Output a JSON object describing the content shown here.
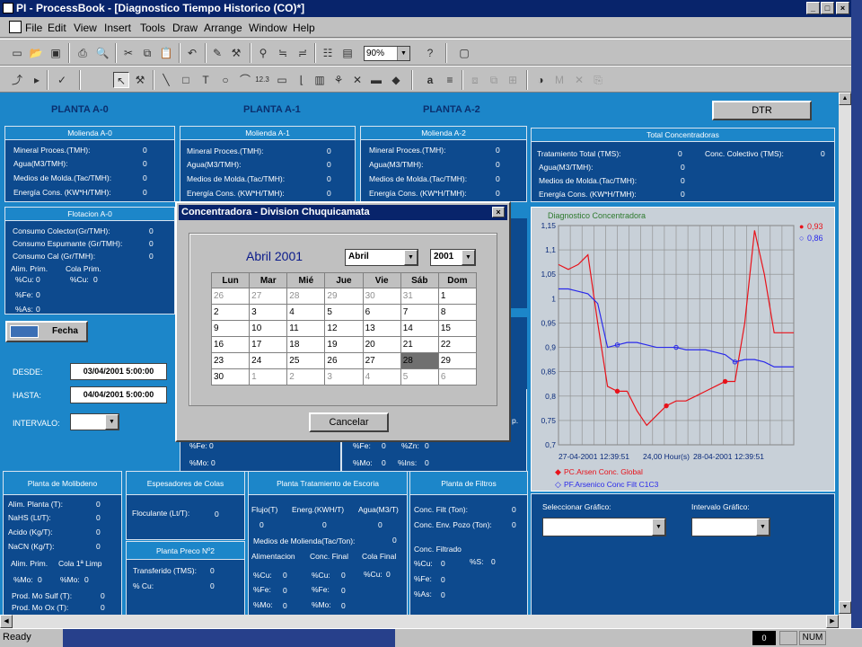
{
  "window": {
    "title": "PI - ProcessBook - [Diagnostico Tiempo Historico (CO)*]"
  },
  "menu": {
    "items": [
      "File",
      "Edit",
      "View",
      "Insert",
      "Tools",
      "Draw",
      "Arrange",
      "Window",
      "Help"
    ]
  },
  "toolbar": {
    "zoom": "90%"
  },
  "plants": [
    "PLANTA A-0",
    "PLANTA A-1",
    "PLANTA A-2"
  ],
  "dtr_button": "DTR",
  "molienda": [
    {
      "title": "Molienda A-0",
      "rows": [
        {
          "label": "Mineral Proces.(TMH):",
          "value": "0"
        },
        {
          "label": "Agua(M3/TMH):",
          "value": "0"
        },
        {
          "label": "Medios de Molda.(Tac/TMH):",
          "value": "0"
        },
        {
          "label": "Energía Cons. (KW*H/TMH):",
          "value": "0"
        }
      ]
    },
    {
      "title": "Molienda A-1",
      "rows": [
        {
          "label": "Mineral Proces.(TMH):",
          "value": "0"
        },
        {
          "label": "Agua(M3/TMH):",
          "value": "0"
        },
        {
          "label": "Medios de Molda.(Tac/TMH):",
          "value": "0"
        },
        {
          "label": "Energía Cons. (KW*H/TMH):",
          "value": "0"
        }
      ]
    },
    {
      "title": "Molienda A-2",
      "rows": [
        {
          "label": "Mineral Proces.(TMH):",
          "value": "0"
        },
        {
          "label": "Agua(M3/TMH):",
          "value": "0"
        },
        {
          "label": "Medios de Molda.(Tac/TMH):",
          "value": "0"
        },
        {
          "label": "Energía Cons. (KW*H/TMH):",
          "value": "0"
        }
      ]
    }
  ],
  "total": {
    "title": "Total Concentradoras",
    "rows": [
      {
        "label": "Tratamiento Total (TMS):",
        "value": "0"
      },
      {
        "label": "Agua(M3/TMH):",
        "value": "0"
      },
      {
        "label": "Medios de Molda.(Tac/TMH):",
        "value": "0"
      },
      {
        "label": "Energía Cons. (KW*H/TMH):",
        "value": "0"
      }
    ],
    "colectivo_label": "Conc. Colectivo (TMS):",
    "colectivo_value": "0"
  },
  "flotacion": {
    "title": "Flotacion A-0",
    "rows": [
      {
        "label": "Consumo Colector(Gr/TMH):",
        "value": "0"
      },
      {
        "label": "Consumo Espumante (Gr/TMH):",
        "value": "0"
      },
      {
        "label": "Consumo Cal (Gr/TMH):",
        "value": "0"
      }
    ],
    "alim_label": "Alim. Prim.",
    "cola_label": "Cola Prim.",
    "cu_label": "%Cu:",
    "cu_alim": "0",
    "cu_cola": "0",
    "fe_label": "%Fe:",
    "fe_value": "0",
    "as_label": "%As:",
    "as_value": "0"
  },
  "fecha": {
    "button": "Fecha",
    "desde_label": "DESDE:",
    "desde_value": "03/04/2001 5:00:00",
    "hasta_label": "HASTA:",
    "hasta_value": "04/04/2001 5:00:00",
    "intervalo_label": "INTERVALO:"
  },
  "hidden_fragments": {
    "fe_label": "%Fe:",
    "fe_value": "0",
    "mo_label": "%Mo:",
    "mo_value": "0",
    "fe2_label": "%Fe:",
    "fe2_value": "0",
    "zn_label": "%Zn:",
    "zn_value": "0",
    "mo2_label": "%Mo:",
    "mo2_value": "0",
    "ins_label": "%Ins:",
    "ins_value": "0",
    "p_label": "p."
  },
  "dialog": {
    "title": "Concentradora - Division Chuquicamata",
    "month_title": "Abril 2001",
    "month_select": "Abril",
    "year_select": "2001",
    "weekdays": [
      "Lun",
      "Mar",
      "Mié",
      "Jue",
      "Vie",
      "Sáb",
      "Dom"
    ],
    "weeks": [
      [
        "26",
        "27",
        "28",
        "29",
        "30",
        "31",
        "1"
      ],
      [
        "2",
        "3",
        "4",
        "5",
        "6",
        "7",
        "8"
      ],
      [
        "9",
        "10",
        "11",
        "12",
        "13",
        "14",
        "15"
      ],
      [
        "16",
        "17",
        "18",
        "19",
        "20",
        "21",
        "22"
      ],
      [
        "23",
        "24",
        "25",
        "26",
        "27",
        "28",
        "29"
      ],
      [
        "30",
        "1",
        "2",
        "3",
        "4",
        "5",
        "6"
      ]
    ],
    "cancel": "Cancelar"
  },
  "molibdeno": {
    "title": "Planta de Molibdeno",
    "rows": [
      {
        "label": "Alim. Planta (T):",
        "value": "0"
      },
      {
        "label": "NaHS (Lt/T):",
        "value": "0"
      },
      {
        "label": "Acido (Kg/T):",
        "value": "0"
      },
      {
        "label": "NaCN (Kg/T):",
        "value": "0"
      }
    ],
    "alim_prim": "Alim. Prim.",
    "cola_limp": "Cola 1ª Limp",
    "mo_label": "%Mo:",
    "mo_alim": "0",
    "mo_cola": "0",
    "sulf_label": "Prod. Mo Sulf (T):",
    "sulf_value": "0",
    "ox_label": "Prod. Mo Ox (T):",
    "ox_value": "0"
  },
  "espesadores": {
    "title": "Espesadores de Colas",
    "label": "Floculante (Lt/T):",
    "value": "0"
  },
  "preco": {
    "title": "Planta Preco Nº2",
    "rows": [
      {
        "label": "Transferido (TMS):",
        "value": "0"
      },
      {
        "label": "% Cu:",
        "value": "0"
      }
    ]
  },
  "escoria": {
    "title": "Planta Tratamiento de Escoria",
    "h1": [
      "Flujo(T)",
      "Energ.(KWH/T)",
      "Agua(M3/T)"
    ],
    "h1_values": [
      "0",
      "0",
      "0"
    ],
    "medios_label": "Medios de Molienda(Tac/Ton):",
    "medios_value": "0",
    "h2": [
      "Alimentacion",
      "Conc. Final",
      "Cola Final"
    ],
    "cu_label": "%Cu:",
    "fe_label": "%Fe:",
    "mo_label": "%Mo:",
    "cu_vals": [
      "0",
      "0",
      "0"
    ],
    "fe_vals": [
      "0",
      "0"
    ],
    "mo_vals": [
      "0",
      "0"
    ]
  },
  "filtros": {
    "title": "Planta de Filtros",
    "rows": [
      {
        "label": "Conc. Filt (Ton):",
        "value": "0"
      },
      {
        "label": "Conc. Env. Pozo (Ton):",
        "value": "0"
      }
    ],
    "filtrado_label": "Conc. Filtrado",
    "cu_label": "%Cu:",
    "cu_value": "0",
    "s_label": "%S:",
    "s_value": "0",
    "fe_label": "%Fe:",
    "fe_value": "0",
    "as_label": "%As:",
    "as_value": "0"
  },
  "selectors": {
    "grafico_label": "Seleccionar Gráfico:",
    "intervalo_label": "Intervalo Gráfico:"
  },
  "status": {
    "text": "Ready",
    "page": "0",
    "num": "NUM"
  },
  "chart_data": {
    "type": "line",
    "title": "Diagnostico Concentradora",
    "ylim": [
      0.7,
      1.15
    ],
    "yticks": [
      "1,15",
      "1,1",
      "1,05",
      "1",
      "0,95",
      "0,9",
      "0,85",
      "0,8",
      "0,75",
      "0,7"
    ],
    "x_start_label": "27-04-2001 12:39:51",
    "x_span_label": "24,00 Hour(s)",
    "x_end_label": "28-04-2001 12:39:51",
    "series": [
      {
        "name": "PC.Arsen Conc. Global",
        "current": "0,93",
        "color": "#e8121a",
        "x": [
          0,
          1,
          2,
          3,
          4,
          5,
          6,
          7,
          8,
          9,
          10,
          11,
          12,
          13,
          14,
          15,
          16,
          17,
          18,
          19,
          20,
          21,
          22,
          23,
          24
        ],
        "y": [
          1.07,
          1.06,
          1.07,
          1.09,
          0.95,
          0.82,
          0.81,
          0.81,
          0.77,
          0.74,
          0.76,
          0.78,
          0.79,
          0.79,
          0.8,
          0.81,
          0.82,
          0.83,
          0.83,
          0.95,
          1.14,
          1.05,
          0.93,
          0.93,
          0.93
        ]
      },
      {
        "name": "PF.Arsenico Conc Filt C1C3",
        "current": "0,86",
        "color": "#2a2aea",
        "x": [
          0,
          1,
          2,
          3,
          4,
          5,
          6,
          7,
          8,
          9,
          10,
          11,
          12,
          13,
          14,
          15,
          16,
          17,
          18,
          19,
          20,
          21,
          22,
          23,
          24
        ],
        "y": [
          1.02,
          1.02,
          1.015,
          1.01,
          0.99,
          0.9,
          0.905,
          0.91,
          0.91,
          0.905,
          0.9,
          0.9,
          0.9,
          0.895,
          0.895,
          0.895,
          0.89,
          0.885,
          0.87,
          0.875,
          0.875,
          0.87,
          0.86,
          0.86,
          0.86
        ]
      }
    ]
  }
}
